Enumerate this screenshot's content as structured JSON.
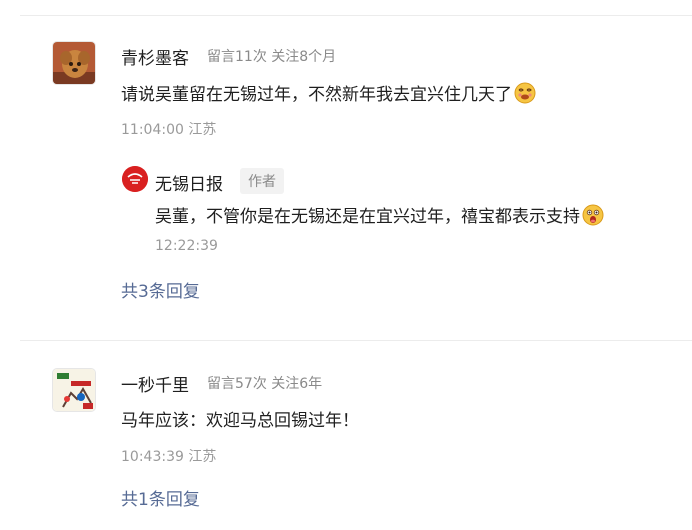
{
  "comments": [
    {
      "nickname": "青杉墨客",
      "stats": "留言11次 关注8个月",
      "text": "请说吴董留在无锡过年，不然新年我去宜兴住几天了",
      "text_emoji": "dizzy-face-emoji",
      "time": "11:04:00 江苏",
      "reply": {
        "nickname": "无锡日报",
        "tag": "作者",
        "text": "吴董，不管你是在无锡还是在宜兴过年，禧宝都表示支持",
        "text_emoji": "surprised-face-emoji",
        "time": "12:22:39"
      },
      "more_replies": "共3条回复"
    },
    {
      "nickname": "一秒千里",
      "stats": "留言57次 关注6年",
      "text": "马年应该：欢迎马总回锡过年！",
      "time": "10:43:39 江苏",
      "more_replies": "共1条回复"
    }
  ],
  "colors": {
    "link": "#576b95",
    "divider": "#ececec",
    "author_logo": "#d92020"
  }
}
